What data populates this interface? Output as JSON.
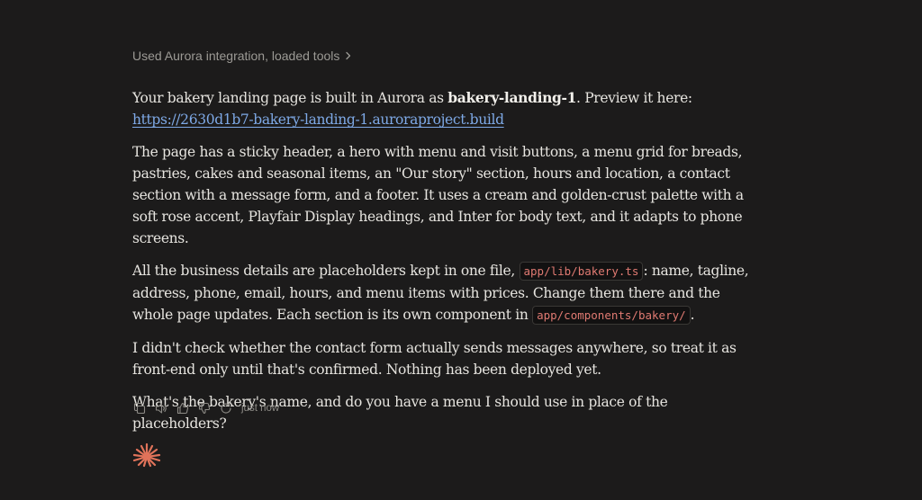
{
  "tools_summary": "Used Aurora integration, loaded tools",
  "message": {
    "p1_a": "Your bakery landing page is built in Aurora as ",
    "p1_bold": "bakery-landing-1",
    "p1_b": ". Preview it here:",
    "preview_link": "https://2630d1b7-bakery-landing-1.auroraproject.build",
    "p2": "The page has a sticky header, a hero with menu and visit buttons, a menu grid for breads, pastries, cakes and seasonal items, an \"Our story\" section, hours and location, a contact section with a message form, and a footer. It uses a cream and golden-crust palette with a soft rose accent, Playfair Display headings, and Inter for body text, and it adapts to phone screens.",
    "p3_a": "All the business details are placeholders kept in one file, ",
    "p3_code1": "app/lib/bakery.ts",
    "p3_b": ": name, tagline, address, phone, email, hours, and menu items with prices. Change them there and the whole page updates. Each section is its own component in ",
    "p3_code2": "app/components/bakery/",
    "p3_c": ".",
    "p4": "I didn't check whether the contact form actually sends messages anywhere, so treat it as front-end only until that's confirmed. Nothing has been deployed yet.",
    "p5": "What's the bakery's name, and do you have a menu I should use in place of the placeholders?"
  },
  "actions": {
    "icons": [
      "copy-icon",
      "speaker-icon",
      "thumbs-up-icon",
      "thumbs-down-icon",
      "retry-icon"
    ],
    "timestamp": "just now"
  },
  "colors": {
    "background": "#1c1b1b",
    "text": "#e6e4df",
    "muted": "#9c9a95",
    "link": "#7ea9e6",
    "code": "#e07a72",
    "logo": "#e0735a"
  }
}
